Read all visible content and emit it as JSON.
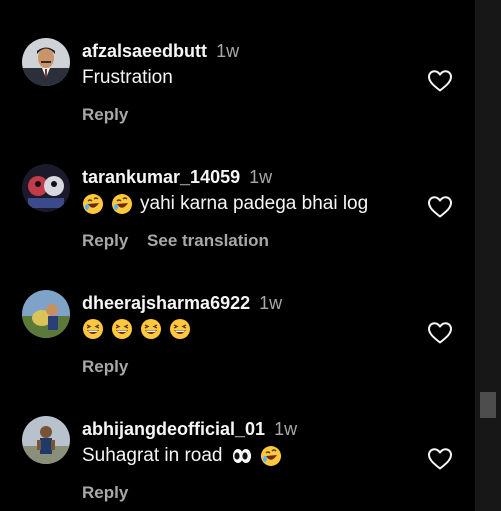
{
  "colors": {
    "background": "#000000",
    "text_primary": "#f5f5f5",
    "text_secondary": "#a8a8a8",
    "scrollbar_track": "#171717",
    "scrollbar_thumb": "#4d4d4d"
  },
  "comments": [
    {
      "username": "afzalsaeedbutt",
      "time": "1w",
      "text": "Frustration",
      "reply_label": "Reply",
      "like_icon": "heart-outline-icon",
      "avatar_icon": "avatar-man-suit"
    },
    {
      "username": "tarankumar_14059",
      "time": "1w",
      "emojis": [
        "rolling-on-floor-laughing",
        "rolling-on-floor-laughing"
      ],
      "text": "yahi karna padega bhai log",
      "reply_label": "Reply",
      "translate_label": "See translation",
      "like_icon": "heart-outline-icon",
      "avatar_icon": "avatar-cartoon"
    },
    {
      "username": "dheerajsharma6922",
      "time": "1w",
      "emojis": [
        "grinning-squinting-face",
        "grinning-squinting-face",
        "grinning-squinting-face",
        "grinning-squinting-face"
      ],
      "reply_label": "Reply",
      "like_icon": "heart-outline-icon",
      "avatar_icon": "avatar-outdoor"
    },
    {
      "username": "abhijangdeofficial_01",
      "time": "1w",
      "text": "Suhagrat in road",
      "emojis_after": [
        "eyes",
        "rolling-on-floor-laughing"
      ],
      "reply_label": "Reply",
      "like_icon": "heart-outline-icon",
      "avatar_icon": "avatar-person-outdoor"
    }
  ]
}
